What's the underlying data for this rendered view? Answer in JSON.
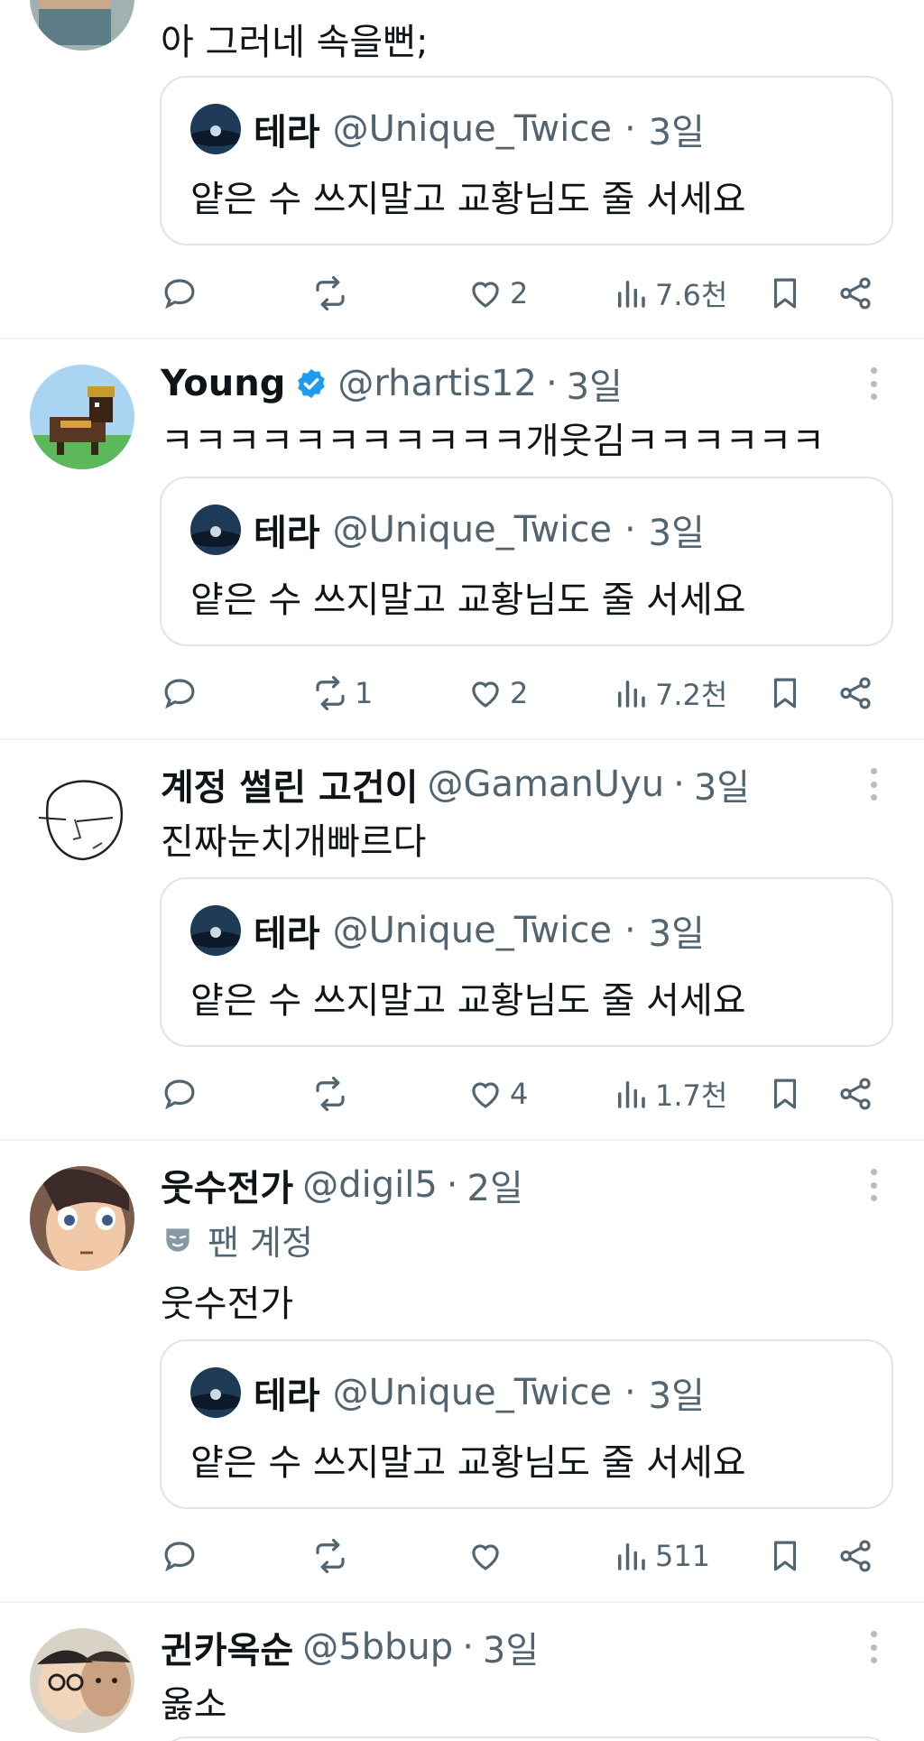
{
  "posts": [
    {
      "avatar_icon": "person-photo-avatar",
      "body": "아 그러네 속을뻔;",
      "quote": {
        "name": "테라",
        "handle": "@Unique_Twice",
        "dot": "·",
        "time": "3일",
        "text": "얕은 수 쓰지말고 교황님도 줄 서세요"
      },
      "actions": {
        "replies": "",
        "reposts": "",
        "likes": "2",
        "views": "7.6천"
      }
    },
    {
      "name": "Young",
      "verified": true,
      "handle": "@rhartis12",
      "dot": "·",
      "time": "3일",
      "avatar_icon": "pixel-dog-avatar",
      "body": "ㅋㅋㅋㅋㅋㅋㅋㅋㅋㅋㅋ개웃김ㅋㅋㅋㅋㅋㅋ",
      "quote": {
        "name": "테라",
        "handle": "@Unique_Twice",
        "dot": "·",
        "time": "3일",
        "text": "얕은 수 쓰지말고 교황님도 줄 서세요"
      },
      "actions": {
        "replies": "",
        "reposts": "1",
        "likes": "2",
        "views": "7.2천"
      }
    },
    {
      "name": "계정 썰린 고건이",
      "handle": "@GamanUyu",
      "dot": "·",
      "time": "3일",
      "avatar_icon": "sketch-drawing-avatar",
      "body": "진짜눈치개빠르다",
      "quote": {
        "name": "테라",
        "handle": "@Unique_Twice",
        "dot": "·",
        "time": "3일",
        "text": "얕은 수 쓰지말고 교황님도 줄 서세요"
      },
      "actions": {
        "replies": "",
        "reposts": "",
        "likes": "4",
        "views": "1.7천"
      }
    },
    {
      "name": "웃수전가",
      "handle": "@digil5",
      "dot": "·",
      "time": "2일",
      "avatar_icon": "anime-face-avatar",
      "fan_label": "팬 계정",
      "body": "웃수전가",
      "quote": {
        "name": "테라",
        "handle": "@Unique_Twice",
        "dot": "·",
        "time": "3일",
        "text": "얕은 수 쓰지말고 교황님도 줄 서세요"
      },
      "actions": {
        "replies": "",
        "reposts": "",
        "likes": "",
        "views": "511"
      }
    },
    {
      "name": "귄카옥순",
      "handle": "@5bbup",
      "dot": "·",
      "time": "3일",
      "avatar_icon": "couple-photo-avatar",
      "body": "옳소"
    }
  ],
  "colors": {
    "accent_verified": "#1d9bf0",
    "secondary_text": "#536471",
    "border": "#dfe4e8"
  }
}
